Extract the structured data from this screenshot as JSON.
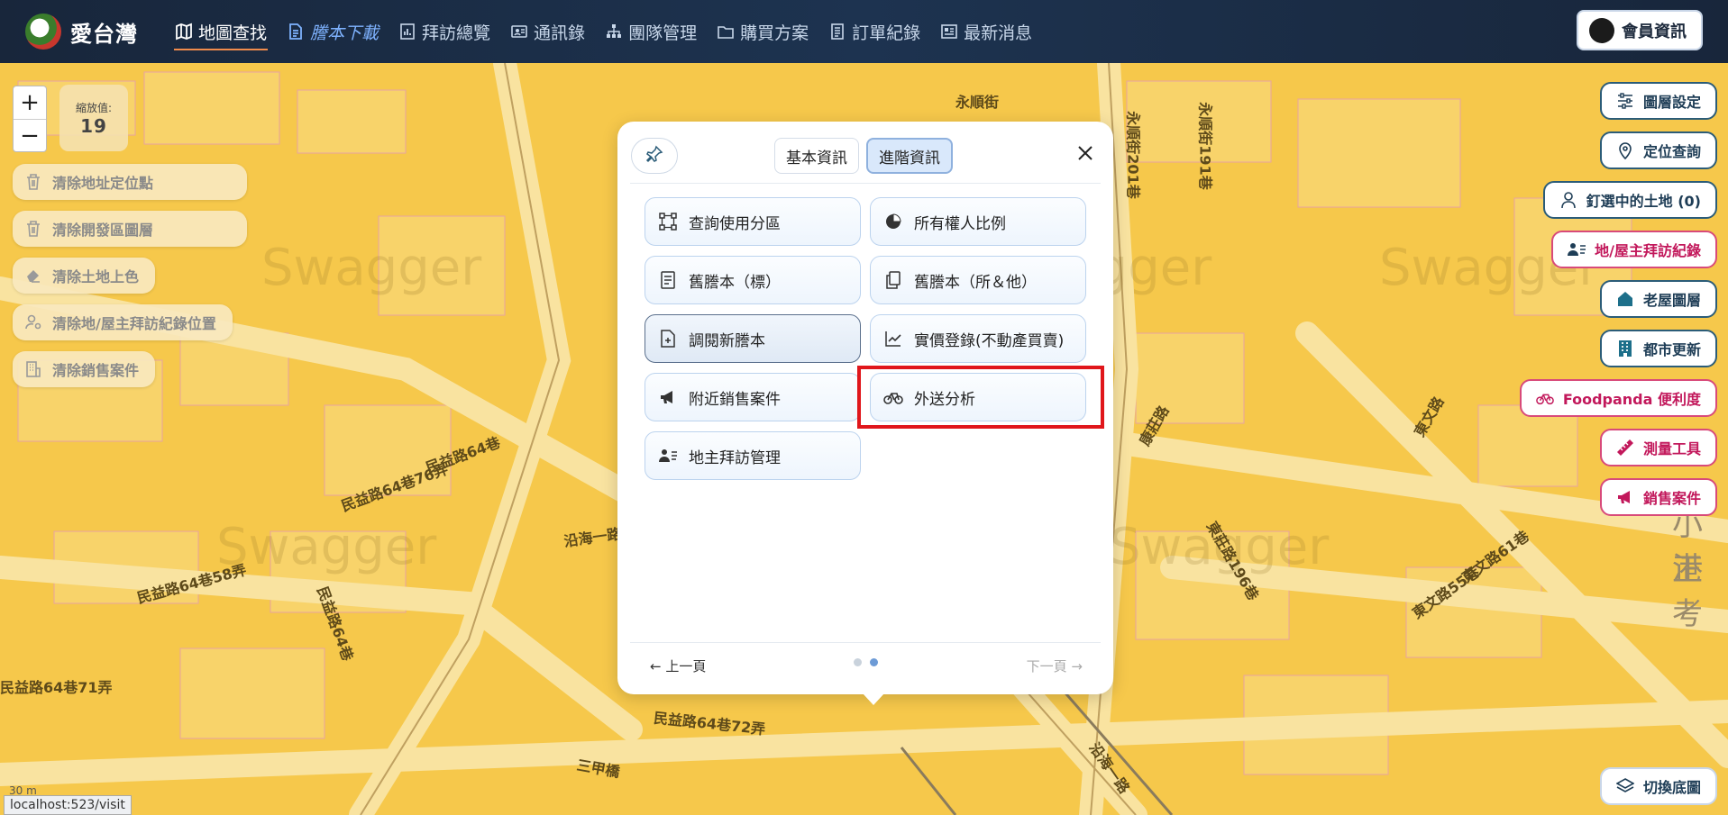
{
  "brand": {
    "name": "愛台灣"
  },
  "nav": [
    {
      "label": "地圖查找",
      "icon": "map-icon"
    },
    {
      "label": "謄本下載",
      "icon": "document-icon"
    },
    {
      "label": "拜訪總覽",
      "icon": "bar-chart-icon"
    },
    {
      "label": "通訊錄",
      "icon": "contact-card-icon"
    },
    {
      "label": "團隊管理",
      "icon": "org-chart-icon"
    },
    {
      "label": "購買方案",
      "icon": "folder-icon"
    },
    {
      "label": "訂單紀錄",
      "icon": "receipt-icon"
    },
    {
      "label": "最新消息",
      "icon": "newspaper-icon"
    }
  ],
  "member": {
    "label": "會員資訊"
  },
  "zoom": {
    "plus": "+",
    "minus": "−",
    "level_label": "縮放值:",
    "level_value": "19"
  },
  "left_buttons": [
    {
      "label": "清除地址定位點",
      "icon": "trash-icon"
    },
    {
      "label": "清除開發區圖層",
      "icon": "trash-icon"
    },
    {
      "label": "清除土地上色",
      "icon": "eraser-icon"
    },
    {
      "label": "清除地/屋主拜訪紀錄位置",
      "icon": "user-location-icon"
    },
    {
      "label": "清除銷售案件",
      "icon": "building-icon"
    }
  ],
  "right_buttons": [
    {
      "label": "圖層設定",
      "icon": "sliders-icon"
    },
    {
      "label": "定位查詢",
      "icon": "location-pin-icon"
    },
    {
      "label": "釘選中的土地 (0)",
      "icon": "user-pin-icon"
    },
    {
      "label": "地/屋主拜訪紀錄",
      "icon": "user-list-icon"
    },
    {
      "label": "老屋圖層",
      "icon": "house-icon"
    },
    {
      "label": "都市更新",
      "icon": "building-icon"
    },
    {
      "label": "Foodpanda 便利度",
      "icon": "bicycle-icon"
    },
    {
      "label": "測量工具",
      "icon": "ruler-icon"
    },
    {
      "label": "銷售案件",
      "icon": "megaphone-icon"
    }
  ],
  "bottom_right": {
    "label": "切換底圖",
    "icon": "layers-icon"
  },
  "popup": {
    "tabs": [
      "基本資訊",
      "進階資訊"
    ],
    "active_tab": "進階資訊",
    "menu": [
      {
        "label": "查詢使用分區",
        "icon": "scan-icon"
      },
      {
        "label": "所有權人比例",
        "icon": "pie-chart-icon"
      },
      {
        "label": "舊謄本（標）",
        "icon": "document-list-icon"
      },
      {
        "label": "舊謄本（所＆他）",
        "icon": "copy-icon"
      },
      {
        "label": "調閱新謄本",
        "icon": "file-plus-icon"
      },
      {
        "label": "實價登錄(不動產買賣)",
        "icon": "line-chart-icon"
      },
      {
        "label": "附近銷售案件",
        "icon": "megaphone-icon"
      },
      {
        "label": "外送分析",
        "icon": "bicycle-icon"
      },
      {
        "label": "地主拜訪管理",
        "icon": "user-list-icon"
      }
    ],
    "prev_label": "← 上一頁",
    "next_label": "下一頁 →"
  },
  "map": {
    "watermark": "Swagger",
    "roads": [
      "永順街",
      "民益路64巷",
      "民益路64巷76弄",
      "沿海一路160巷",
      "民益路64巷58弄",
      "民益路64巷71弄",
      "民益路64巷72弄",
      "康莊路",
      "東文路",
      "東文路61巷",
      "東文路55巷",
      "東莊路196巷",
      "沿海一路",
      "永順街201巷",
      "永順街191巷",
      "民益路64巷",
      "三甲橋"
    ],
    "scale": "30 m",
    "right_edge_text": [
      "小港",
      "正考"
    ]
  },
  "status_url": "localhost:523/visit",
  "colors": {
    "nav_bg": "#1b2b44",
    "map_bg": "#f5c74a",
    "highlight": "#e0161b",
    "pink": "#c2185b",
    "teal": "#1e3d56"
  }
}
